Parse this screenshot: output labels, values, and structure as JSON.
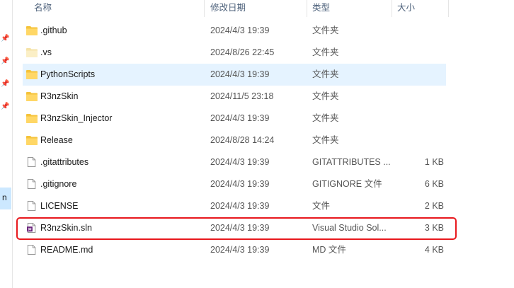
{
  "columns": {
    "name": "名称",
    "date": "修改日期",
    "type": "类型",
    "size": "大小"
  },
  "nav": {
    "selected_letter": "n"
  },
  "files": [
    {
      "name": ".github",
      "date": "2024/4/3 19:39",
      "type": "文件夹",
      "size": "",
      "icon": "folder-icon"
    },
    {
      "name": ".vs",
      "date": "2024/8/26 22:45",
      "type": "文件夹",
      "size": "",
      "icon": "folder-hidden-icon"
    },
    {
      "name": "PythonScripts",
      "date": "2024/4/3 19:39",
      "type": "文件夹",
      "size": "",
      "icon": "folder-icon"
    },
    {
      "name": "R3nzSkin",
      "date": "2024/11/5 23:18",
      "type": "文件夹",
      "size": "",
      "icon": "folder-icon"
    },
    {
      "name": "R3nzSkin_Injector",
      "date": "2024/4/3 19:39",
      "type": "文件夹",
      "size": "",
      "icon": "folder-icon"
    },
    {
      "name": "Release",
      "date": "2024/8/28 14:24",
      "type": "文件夹",
      "size": "",
      "icon": "folder-icon"
    },
    {
      "name": ".gitattributes",
      "date": "2024/4/3 19:39",
      "type": "GITATTRIBUTES ...",
      "size": "1 KB",
      "icon": "file-icon"
    },
    {
      "name": ".gitignore",
      "date": "2024/4/3 19:39",
      "type": "GITIGNORE 文件",
      "size": "6 KB",
      "icon": "file-icon"
    },
    {
      "name": "LICENSE",
      "date": "2024/4/3 19:39",
      "type": "文件",
      "size": "2 KB",
      "icon": "file-icon"
    },
    {
      "name": "R3nzSkin.sln",
      "date": "2024/4/3 19:39",
      "type": "Visual Studio Sol...",
      "size": "3 KB",
      "icon": "visual-studio-solution-icon"
    },
    {
      "name": "README.md",
      "date": "2024/4/3 19:39",
      "type": "MD 文件",
      "size": "4 KB",
      "icon": "file-icon"
    }
  ],
  "colors": {
    "folder": "#f2c94c",
    "hover_row": "#e5f3ff",
    "highlight_border": "#e8181d",
    "vs_purple": "#68217a"
  }
}
